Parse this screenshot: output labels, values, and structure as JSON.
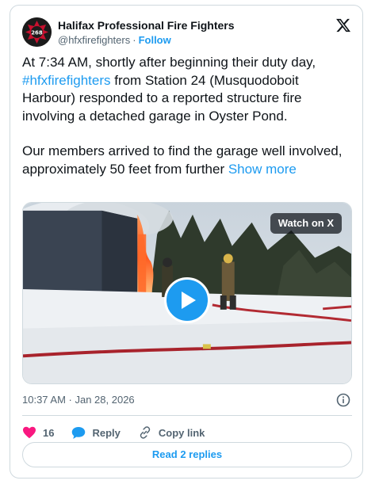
{
  "author": {
    "name": "Halifax Professional Fire Fighters",
    "handle": "@hfxfirefighters",
    "separator": "·",
    "follow_label": "Follow",
    "avatar_badge": "268"
  },
  "tweet": {
    "text_part1": "At 7:34 AM, shortly after beginning their duty day, ",
    "hashtag": "#hfxfirefighters",
    "text_part2": " from Station 24 (Musquodoboit Harbour) responded to a reported structure fire involving a detached garage in Oyster Pond.",
    "text_part3": "Our members arrived to find the garage well involved, approximately 50 feet from further ",
    "show_more": "Show more"
  },
  "media": {
    "watch_label": "Watch on X"
  },
  "meta": {
    "timestamp": "10:37 AM · Jan 28, 2026"
  },
  "actions": {
    "like_count": "16",
    "reply_label": "Reply",
    "copy_label": "Copy link"
  },
  "footer": {
    "read_replies_label": "Read 2 replies"
  },
  "colors": {
    "accent": "#1d9bf0",
    "like": "#f91880",
    "text": "#0f1419",
    "muted": "#536471",
    "border": "#cfd9de"
  },
  "icons": [
    "x-logo-icon",
    "heart-icon",
    "reply-bubble-icon",
    "link-icon",
    "info-icon",
    "play-icon"
  ]
}
